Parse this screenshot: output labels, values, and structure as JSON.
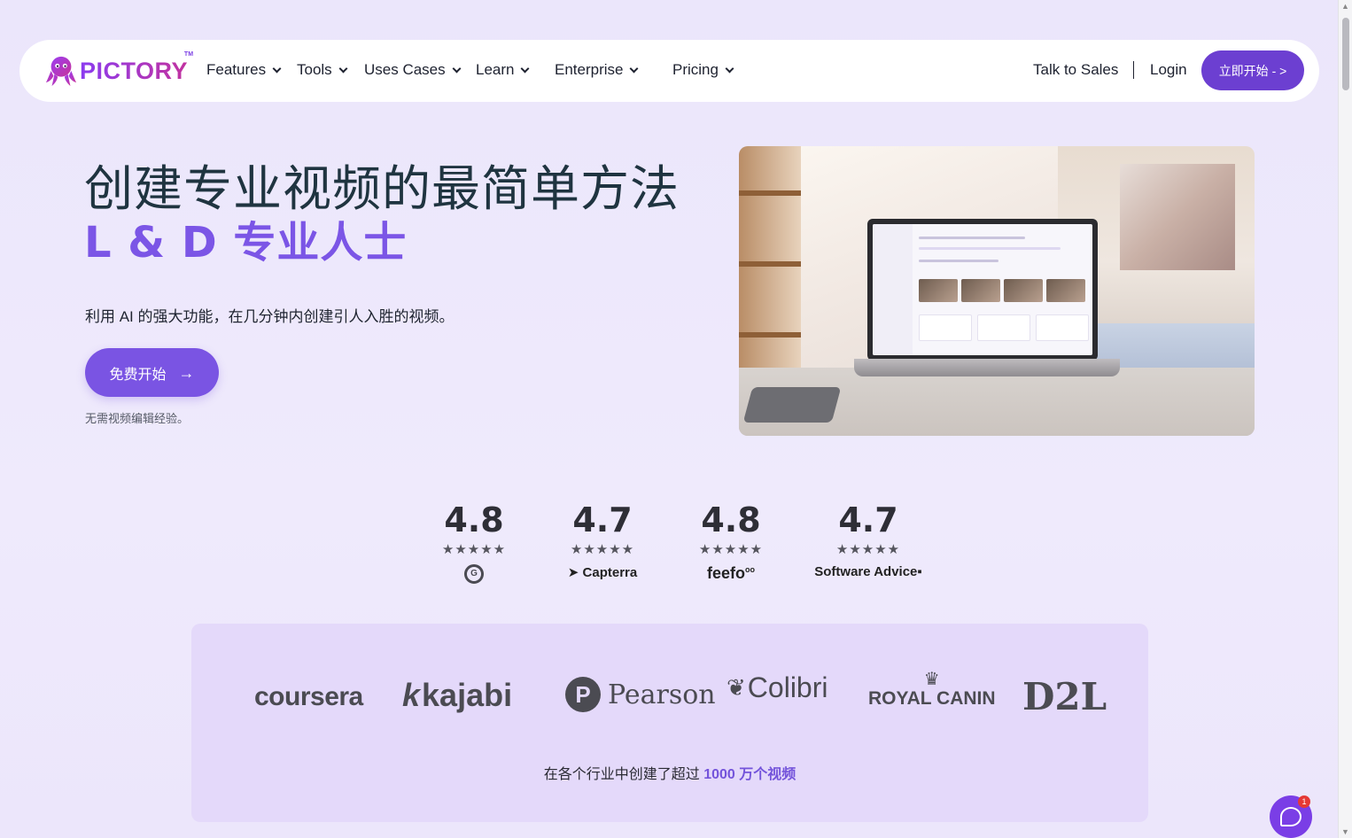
{
  "brand": {
    "logo_text": "PICTORY",
    "tm": "TM"
  },
  "nav": {
    "items": [
      {
        "label": "Features"
      },
      {
        "label": "Tools"
      },
      {
        "label": "Uses Cases"
      },
      {
        "label": "Learn"
      },
      {
        "label": "Enterprise"
      },
      {
        "label": "Pricing"
      }
    ],
    "talk_to_sales": "Talk to Sales",
    "login": "Login",
    "cta": "立即开始 - >"
  },
  "hero": {
    "title": "创建专业视频的最简单方法",
    "subtitle": "L & D 专业人士",
    "description": "利用 AI 的强大功能，在几分钟内创建引人入胜的视频。",
    "cta": "免费开始",
    "note": "无需视频编辑经验。"
  },
  "ratings": [
    {
      "score": "4.8",
      "stars": "★★★★★",
      "brand": "G2",
      "icon": "g2-logo-icon"
    },
    {
      "score": "4.7",
      "stars": "★★★★★",
      "brand": "Capterra",
      "icon": "capterra-logo-icon"
    },
    {
      "score": "4.8",
      "stars": "★★★★★",
      "brand": "feefo",
      "icon": "feefo-logo-icon"
    },
    {
      "score": "4.7",
      "stars": "★★★★★",
      "brand": "Software Advice",
      "icon": "software-advice-logo-icon"
    }
  ],
  "customer_logos": {
    "coursera": "coursera",
    "kajabi": "kajabi",
    "pearson": "Pearson",
    "colibri": "Colibri",
    "royal_canin": "ROYAL CANIN",
    "d2l": "D2L",
    "caption_prefix": "在各个行业中创建了超过 ",
    "caption_highlight": "1000 万个视频"
  },
  "chat": {
    "badge": "1"
  },
  "colors": {
    "accent": "#7a54e3",
    "nav_cta": "#6c3fd1",
    "background": "#ece8fb",
    "logos_panel": "#e4d9fa"
  }
}
